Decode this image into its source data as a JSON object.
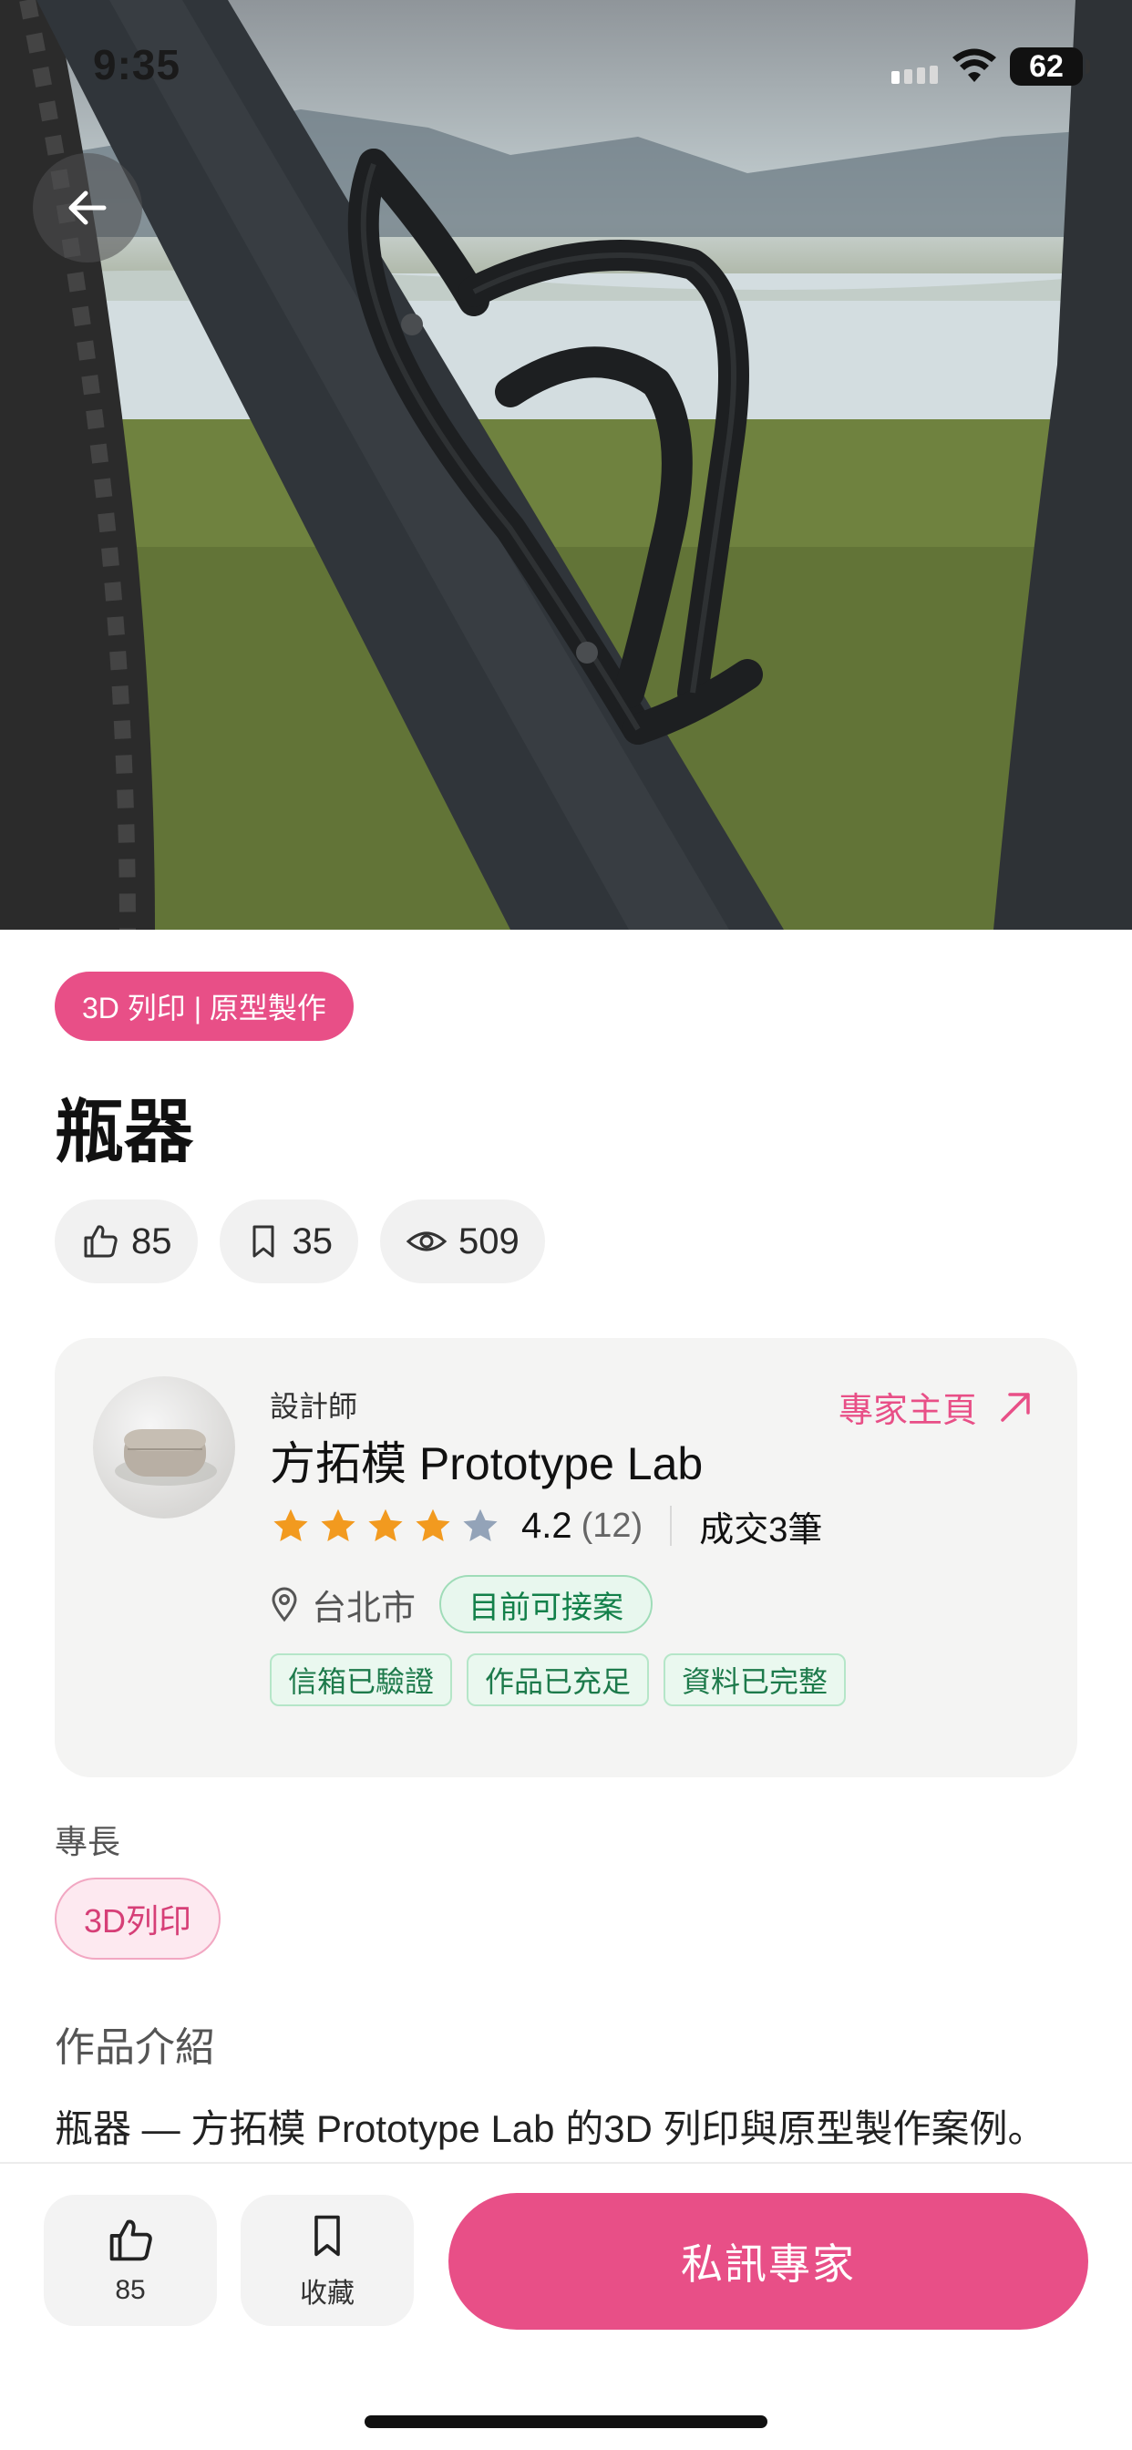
{
  "status_bar": {
    "time": "9:35",
    "battery": "62"
  },
  "hero": {
    "image_subject": "carbon-fiber-bottle-cage-on-bike"
  },
  "work": {
    "category": "3D 列印 | 原型製作",
    "title": "瓶器",
    "stats": {
      "likes": "85",
      "saves": "35",
      "views": "509"
    }
  },
  "designer": {
    "role_label": "設計師",
    "name": "方拓模 Prototype Lab",
    "profile_link_label": "專家主頁",
    "rating": "4.2",
    "rating_count": "(12)",
    "stars_filled": 4,
    "deals": "成交3筆",
    "location": "台北市",
    "availability": "目前可接案",
    "badges": [
      "信箱已驗證",
      "作品已充足",
      "資料已完整"
    ]
  },
  "skills": {
    "label": "專長",
    "items": [
      "3D列印"
    ]
  },
  "intro": {
    "title": "作品介紹",
    "text": "瓶器 — 方拓模 Prototype Lab 的3D 列印與原型製作案例。"
  },
  "bottom_bar": {
    "like_count": "85",
    "save_label": "收藏",
    "cta_label": "私訊專家"
  },
  "colors": {
    "accent": "#e84f87",
    "success": "#13804a",
    "star": "#f29a1f",
    "star_empty": "#93a3b8"
  }
}
